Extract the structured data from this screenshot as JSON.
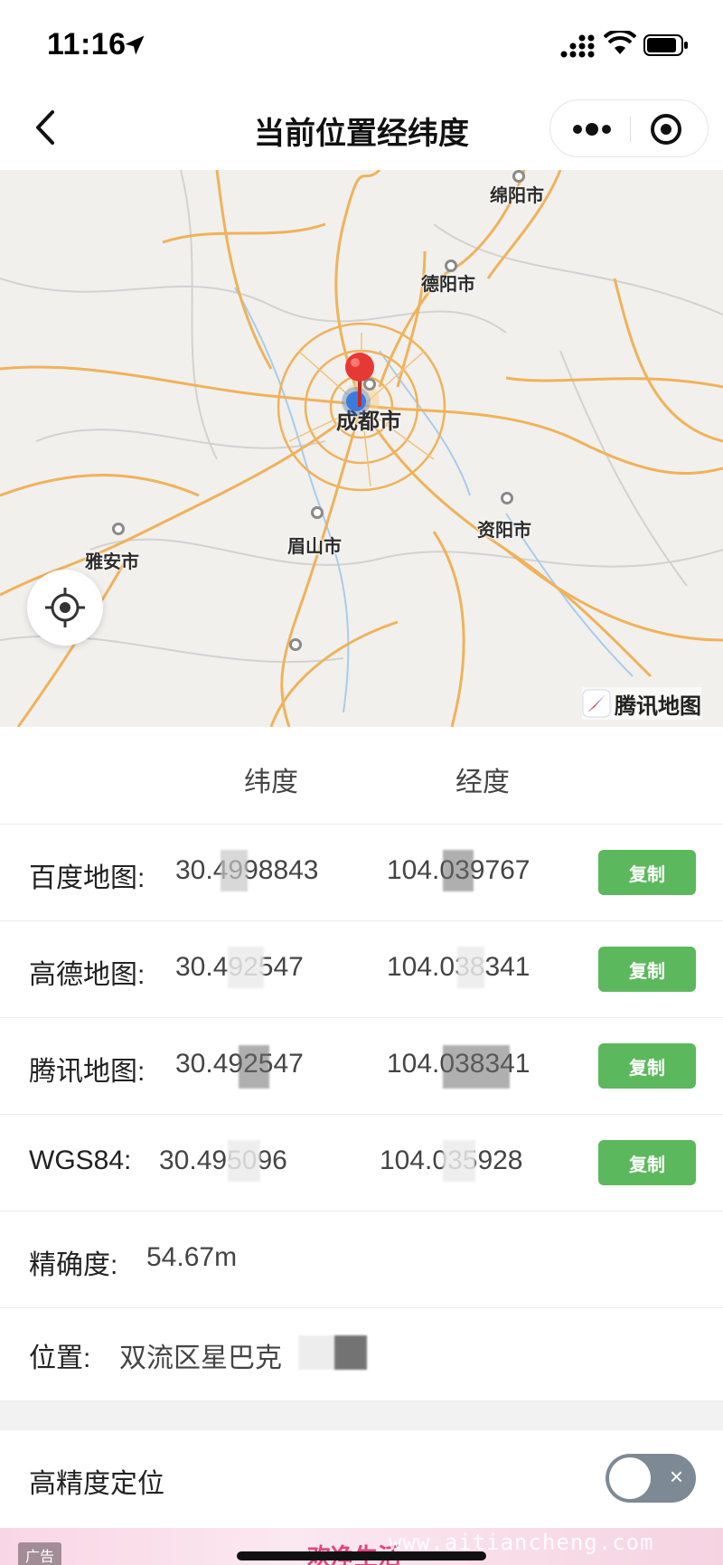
{
  "status_bar": {
    "time": "11:16"
  },
  "nav": {
    "title": "当前位置经纬度"
  },
  "map": {
    "cities": [
      {
        "name": "绵阳市",
        "key": "mianyang"
      },
      {
        "name": "德阳市",
        "key": "deyang"
      },
      {
        "name": "成都市",
        "key": "chengdu"
      },
      {
        "name": "眉山市",
        "key": "meishan"
      },
      {
        "name": "资阳市",
        "key": "ziyang"
      },
      {
        "name": "雅安市",
        "key": "yaan"
      }
    ],
    "logo_text": "腾讯地图",
    "colors": {
      "road": "#f0b25a",
      "minor_road": "#cfcfcf",
      "river": "#9cc4ea",
      "pin": "#e53935",
      "user_dot": "#3a7be0"
    }
  },
  "table": {
    "headers": {
      "lat": "纬度",
      "lng": "经度"
    },
    "rows": [
      {
        "label": "百度地图:",
        "lat": "30.4998843",
        "lng": "104.039767",
        "button": "复制"
      },
      {
        "label": "高德地图:",
        "lat": "30.492547",
        "lng": "104.038341",
        "button": "复制"
      },
      {
        "label": "腾讯地图:",
        "lat": "30.492547",
        "lng": "104.038341",
        "button": "复制"
      },
      {
        "label": "WGS84:",
        "lat": "30.495096",
        "lng": "104.035928",
        "button": "复制"
      }
    ],
    "accuracy_label": "精确度:",
    "accuracy_value": "54.67m",
    "position_label": "位置:",
    "position_value": "双流区星巴克"
  },
  "settings": {
    "high_precision_label": "高精度定位",
    "high_precision_on": false,
    "toggle_symbol": "×"
  },
  "ad": {
    "tag": "广告",
    "text": "欢净生活",
    "watermark": "www.aitiancheng.com"
  },
  "accent_color": "#5cb85c"
}
